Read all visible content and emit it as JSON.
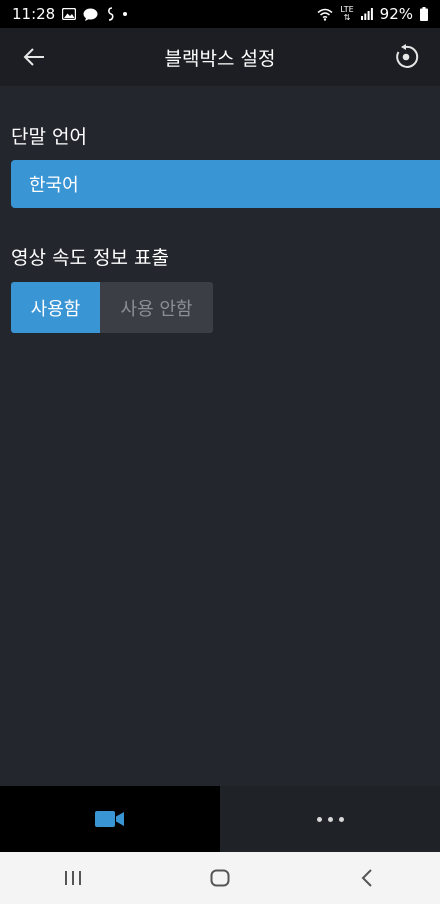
{
  "status_bar": {
    "time": "11:28",
    "battery_level": "92%",
    "network": "LTE"
  },
  "header": {
    "title": "블랙박스 설정"
  },
  "settings": {
    "language": {
      "label": "단말 언어",
      "selected": "한국어"
    },
    "speed_overlay": {
      "label": "영상 속도 정보 표출",
      "options": [
        "사용함",
        "사용 안함"
      ],
      "selected_index": 0
    }
  },
  "tabs": [
    {
      "icon": "video-camera-icon",
      "active": true
    },
    {
      "icon": "more-dots-icon",
      "active": false
    }
  ],
  "colors": {
    "accent": "#3a95d4",
    "background": "#23262d",
    "header": "#1c1e23"
  }
}
